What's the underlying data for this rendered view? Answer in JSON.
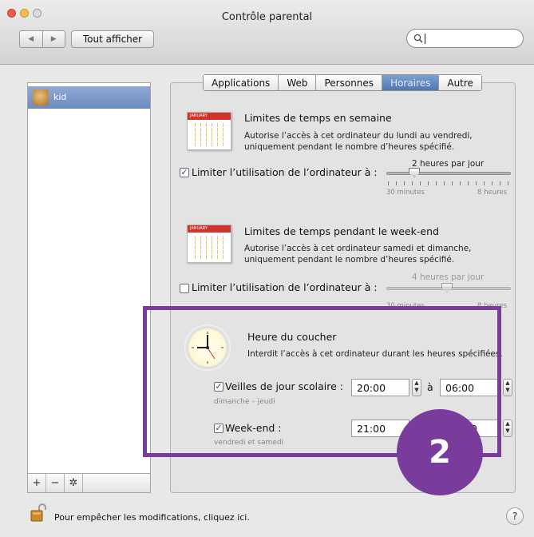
{
  "window": {
    "title": "Contrôle parental",
    "show_all_label": "Tout afficher",
    "back_glyph": "◀",
    "forward_glyph": "▶",
    "search_icon": "magnifier-icon",
    "search_value": "",
    "traffic_colors": [
      "#ee5a4f",
      "#f6be4f",
      "#c5c5c5"
    ]
  },
  "sidebar": {
    "users": [
      {
        "name": "kid",
        "selected": true
      }
    ],
    "add_label": "+",
    "remove_label": "−",
    "gear_label": "✲"
  },
  "tabs": [
    {
      "label": "Applications",
      "active": false
    },
    {
      "label": "Web",
      "active": false
    },
    {
      "label": "Personnes",
      "active": false
    },
    {
      "label": "Horaires",
      "active": true
    },
    {
      "label": "Autre",
      "active": false
    }
  ],
  "weekday": {
    "title": "Limites de temps en semaine",
    "description_line1": "Autorise l’accès à cet ordinateur du lundi au vendredi,",
    "description_line2": "uniquement pendant le nombre d’heures spécifié.",
    "checkbox_label": "Limiter l’utilisation de l’ordinateur à :",
    "checked": true,
    "value_label": "2 heures par jour",
    "min_label": "30 minutes",
    "max_label": "8 heures",
    "slider_value_hours": 2,
    "calendar_label": "JANUARY"
  },
  "weekend": {
    "title": "Limites de temps pendant le week-end",
    "description_line1": "Autorise l’accès à cet ordinateur samedi et dimanche,",
    "description_line2": "uniquement pendant le nombre d’heures spécifié.",
    "checkbox_label": "Limiter l’utilisation de l’ordinateur à :",
    "checked": false,
    "value_label": "4 heures par jour",
    "min_label": "30 minutes",
    "max_label": "8 heures",
    "slider_value_hours": 4,
    "calendar_label": "JANUARY"
  },
  "bedtime": {
    "title": "Heure du coucher",
    "description": "Interdit l’accès à cet ordinateur durant les heures spécifiées.",
    "school_nights": {
      "label": "Veilles de jour scolaire :",
      "checked": true,
      "sub": "dimanche – jeudi",
      "from": "20:00",
      "to_label": "à",
      "to": "06:00"
    },
    "weekend": {
      "label": "Week-end :",
      "checked": true,
      "sub": "vendredi et samedi",
      "from": "21:00",
      "to": "0"
    }
  },
  "annotation": {
    "number": "2",
    "color": "#7a3c9c"
  },
  "footer": {
    "lock_text": "Pour empêcher les modifications, cliquez ici.",
    "help_label": "?"
  }
}
